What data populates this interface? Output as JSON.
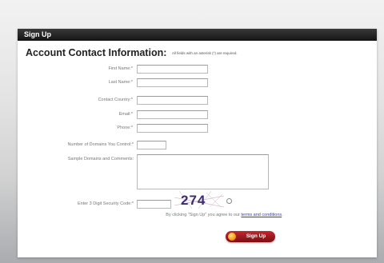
{
  "form": {
    "title": "Sign Up",
    "heading": "Account Contact Information:",
    "required_note": "All fields with an asterisk (*) are required.",
    "labels": {
      "first_name": "First Name:*",
      "last_name": "Last Name:*",
      "contact_country": "Contact Country:*",
      "email": "Email:*",
      "phone": "Phone:*",
      "domains": "Number of Domains You Control:*",
      "sample_domains": "Sample Domains and Comments:",
      "security_code": "Enter 3 Digit Security Code:*"
    },
    "values": {
      "first_name": "",
      "last_name": "",
      "contact_country": "",
      "email": "",
      "phone": "",
      "domains": "",
      "sample_domains": "",
      "security_code": ""
    },
    "captcha_text": "274",
    "terms_prefix": "By clicking \"Sign Up\" you agree to our",
    "terms_link": "terms and conditions",
    "terms_suffix": ".",
    "submit_label": "Sign Up"
  },
  "colors": {
    "title_bar": "#1e1e1e",
    "button": "#a71d22",
    "link": "#2a3fb8",
    "captcha_text": "#3a2c6e"
  },
  "icons": {
    "captcha_refresh": "refresh-icon",
    "submit_bullet": "orange-dot-icon"
  }
}
